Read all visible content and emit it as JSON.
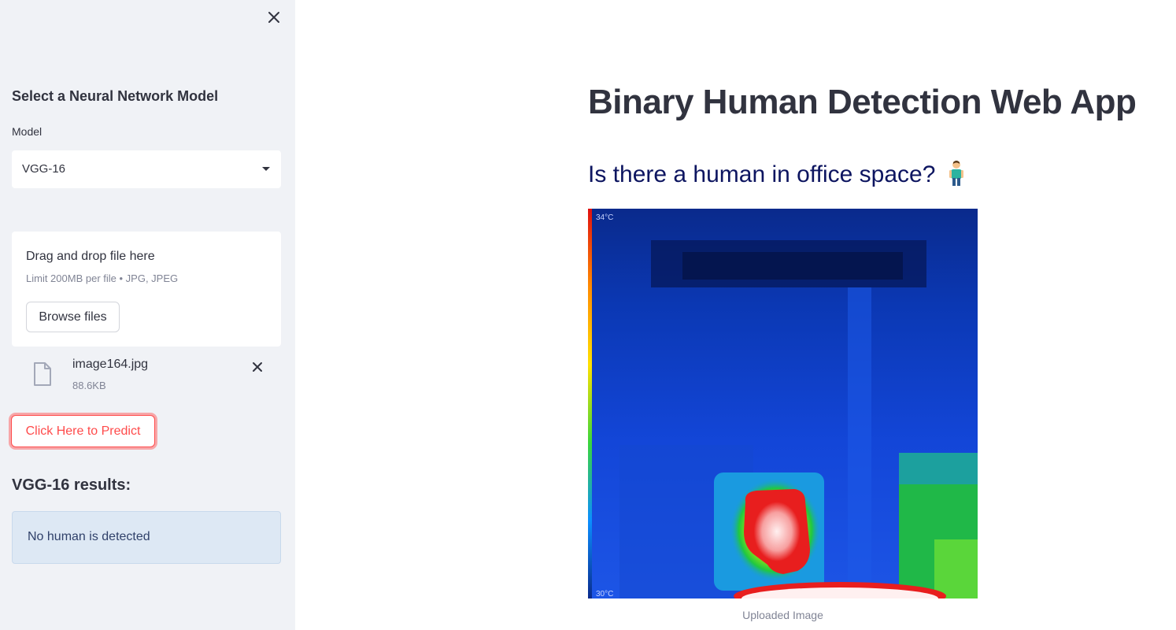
{
  "sidebar": {
    "close_icon": "close-icon",
    "model_heading": "Select a Neural Network Model",
    "model_label": "Model",
    "model_selected": "VGG-16",
    "uploader": {
      "title": "Drag and drop file here",
      "limit": "Limit 200MB per file • JPG, JPEG",
      "browse_label": "Browse files"
    },
    "file": {
      "name": "image164.jpg",
      "size": "88.6KB",
      "icon": "file-icon"
    },
    "predict_label": "Click Here to Predict",
    "results_heading": "VGG-16 results:",
    "result_text": "No human is detected"
  },
  "main": {
    "title": "Binary Human Detection Web App",
    "subtitle": "Is there a human in office space?",
    "image_caption": "Uploaded Image",
    "thermal_labels": {
      "top_temp": "34°C",
      "bottom_temp": "30°C"
    }
  },
  "colors": {
    "accent": "#ff4b4b",
    "sidebar_bg": "#f0f2f6",
    "info_bg": "#dde8f4",
    "subtitle": "#0d1560"
  }
}
